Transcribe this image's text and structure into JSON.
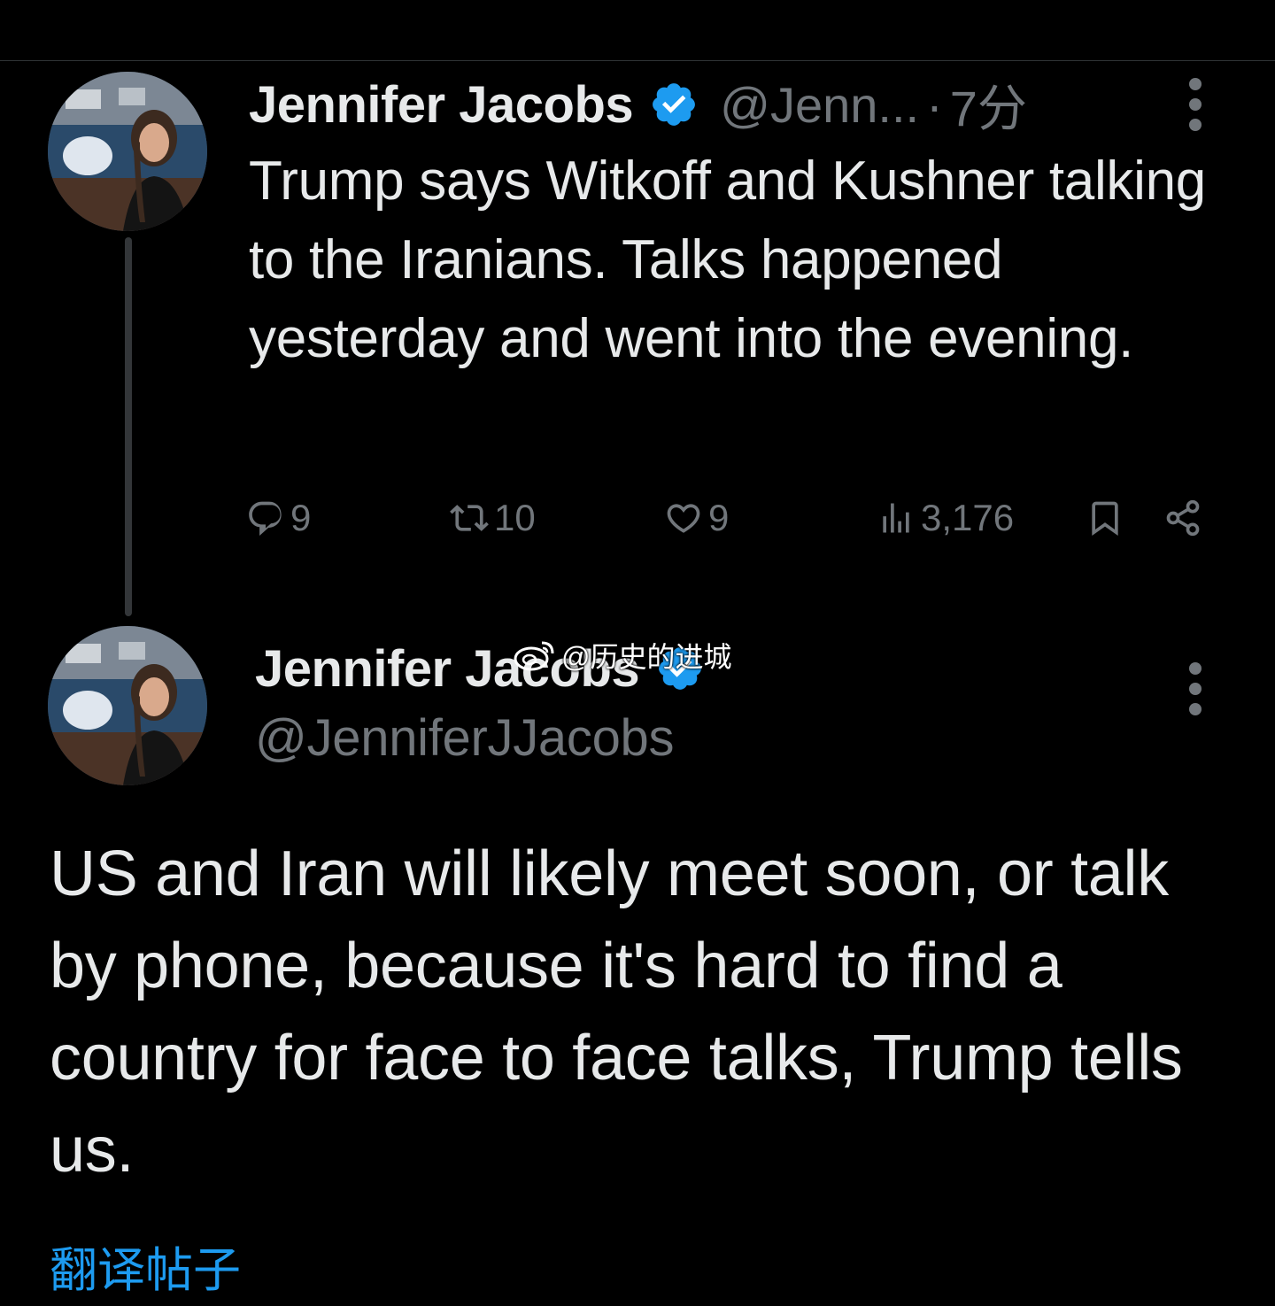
{
  "tweets": [
    {
      "author_name": "Jennifer Jacobs",
      "handle": "@Jenn...",
      "separator": "·",
      "time": "7分",
      "text": "Trump says Witkoff and Kushner talking to the Iranians. Talks happened yesterday and went into the evening.",
      "metrics": {
        "replies": "9",
        "retweets": "10",
        "likes": "9",
        "views": "3,176"
      }
    },
    {
      "author_name": "Jennifer Jacobs",
      "handle": "@JenniferJJacobs",
      "text": "US and Iran will likely meet soon, or talk by phone, because it's hard to find a country for face to face talks, Trump tells us.",
      "translate_label": "翻译帖子"
    }
  ],
  "watermark": "@历史的进城",
  "colors": {
    "background": "#000000",
    "text_primary": "#e7e9ea",
    "text_secondary": "#71767b",
    "accent": "#1d9bf0",
    "divider": "#2f3336"
  },
  "icons": [
    "verified-badge-icon",
    "more-icon",
    "reply-icon",
    "retweet-icon",
    "like-icon",
    "views-icon",
    "bookmark-icon",
    "share-icon",
    "weibo-icon"
  ]
}
